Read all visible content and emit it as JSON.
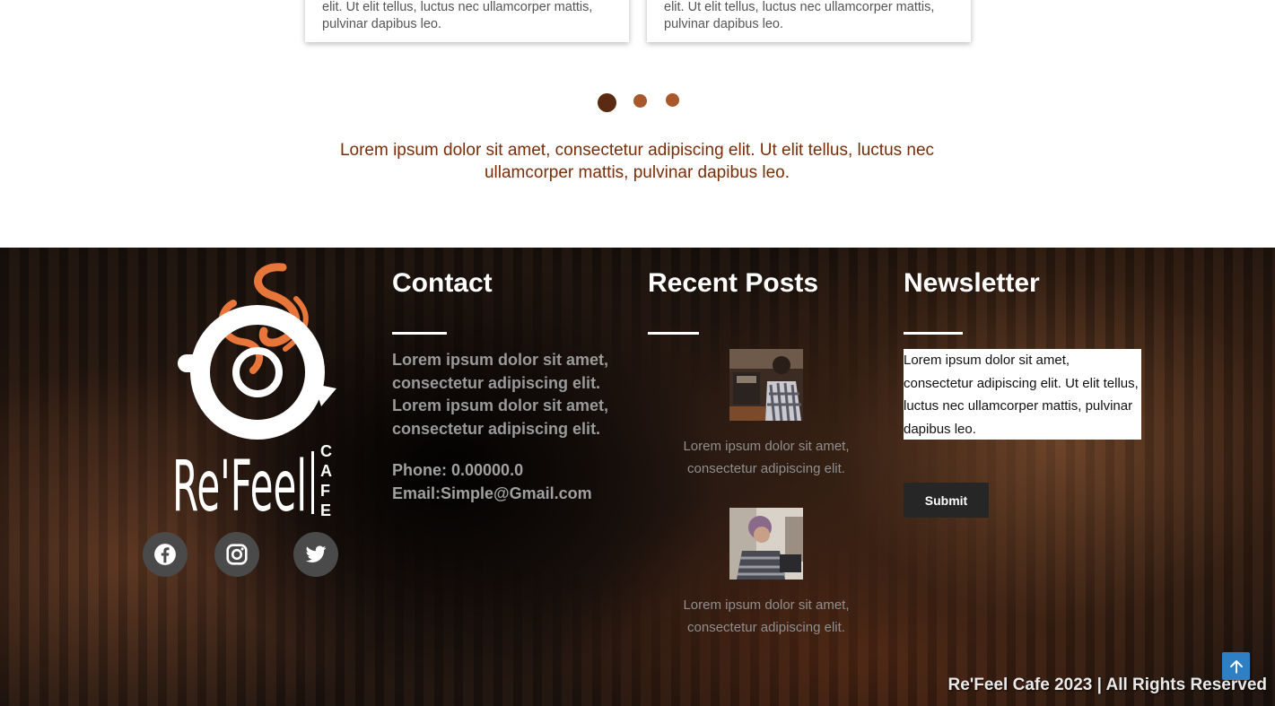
{
  "testimonials": {
    "card_1_text": "elit. Ut elit tellus, luctus nec ullamcorper mattis, pulvinar dapibus leo.",
    "card_2_text": "elit. Ut elit tellus, luctus nec ullamcorper mattis, pulvinar dapibus leo.",
    "active_slide": 1,
    "slide_count": 3
  },
  "tagline": "Lorem ipsum dolor sit amet, consectetur adipiscing elit. Ut elit tellus, luctus nec ullamcorper mattis, pulvinar dapibus leo.",
  "footer": {
    "logo": {
      "wordmark": "Re'Feel",
      "vertical_text": "CAFE",
      "colors": {
        "mark": "#ffffff",
        "steam": "#e8763a"
      }
    },
    "social": [
      {
        "name": "facebook",
        "icon": "facebook-icon"
      },
      {
        "name": "instagram",
        "icon": "instagram-icon"
      },
      {
        "name": "twitter",
        "icon": "twitter-icon"
      }
    ],
    "contact": {
      "title": "Contact",
      "text": "Lorem ipsum dolor sit amet, consectetur adipiscing elit. Lorem ipsum dolor sit amet, consectetur adipiscing elit.",
      "phone": "Phone: 0.00000.0",
      "email": "Email:Simple@Gmail.com"
    },
    "recent_posts": {
      "title": "Recent Posts",
      "posts": [
        {
          "text": "Lorem ipsum dolor sit amet, consectetur adipiscing elit."
        },
        {
          "text": "Lorem ipsum dolor sit amet, consectetur adipiscing elit."
        }
      ]
    },
    "newsletter": {
      "title": "Newsletter",
      "text": "Lorem ipsum dolor sit amet, consectetur adipiscing elit. Ut elit tellus, luctus nec ullamcorper mattis, pulvinar dapibus leo.",
      "submit_label": "Submit"
    },
    "copyright": "Re'Feel Cafe 2023 | All Rights Reserved"
  },
  "colors": {
    "dot_active": "#5a2a12",
    "dot_inactive": "#a8582a",
    "tagline": "#7a2e08",
    "scroll_top": "#2f7fc4"
  }
}
